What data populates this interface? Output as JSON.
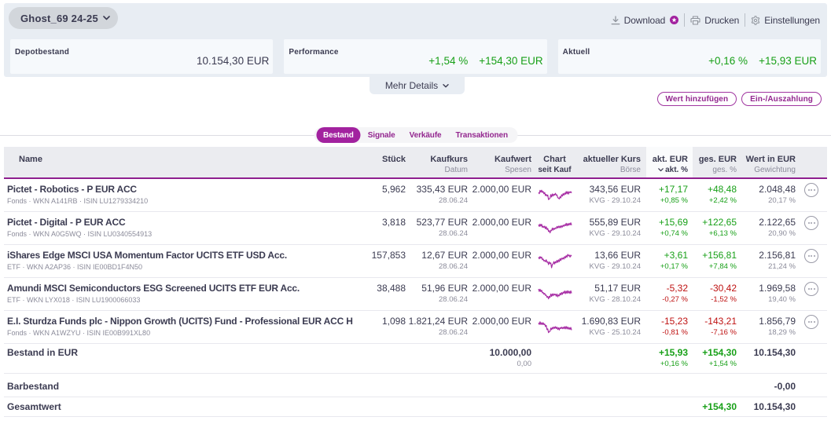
{
  "header": {
    "portfolio_name": "Ghost_69 24-25",
    "actions": {
      "download": "Download",
      "print": "Drucken",
      "settings": "Einstellungen"
    },
    "cards": [
      {
        "label": "Depotbestand",
        "value": "10.154,30 EUR"
      },
      {
        "label": "Performance",
        "pct": "+1,54 %",
        "value": "+154,30 EUR"
      },
      {
        "label": "Aktuell",
        "pct": "+0,16 %",
        "value": "+15,93 EUR"
      }
    ],
    "mehr_details": "Mehr Details"
  },
  "buttons": {
    "add_value": "Wert hinzufügen",
    "payment": "Ein-/Auszahlung"
  },
  "tabs": [
    {
      "label": "Bestand",
      "active": true
    },
    {
      "label": "Signale",
      "active": false
    },
    {
      "label": "Verkäufe",
      "active": false
    },
    {
      "label": "Transaktionen",
      "active": false
    }
  ],
  "table": {
    "columns": {
      "name": "Name",
      "stueck": "Stück",
      "kaufkurs": "Kaufkurs",
      "kaufkurs_sub": "Datum",
      "kaufwert": "Kaufwert",
      "kaufwert_sub": "Spesen",
      "chart": "Chart",
      "chart_sub": "seit Kauf",
      "kurs": "aktueller Kurs",
      "kurs_sub": "Börse",
      "akt": "akt. EUR",
      "akt_sub": "akt. %",
      "ges": "ges. EUR",
      "ges_sub": "ges. %",
      "wert": "Wert in EUR",
      "wert_sub": "Gewichtung"
    },
    "rows": [
      {
        "name": "Pictet - Robotics - P EUR ACC",
        "subtitle": "Fonds · WKN A141RB · ISIN LU1279334210",
        "stueck": "5,962",
        "kaufkurs": "335,43 EUR",
        "kaufdatum": "28.06.24",
        "kaufwert": "2.000,00 EUR",
        "kurs": "343,56 EUR",
        "kurs_sub": "KVG · 29.10.24",
        "akt": "+17,17",
        "akt_pct": "+0,85 %",
        "ges": "+48,48",
        "ges_pct": "+2,42 %",
        "wert": "2.048,48",
        "gewichtung": "20,17 %",
        "spark": [
          0.36,
          0.43,
          0.22,
          0.34,
          0.21,
          0.35,
          0.29,
          0.44,
          0.36,
          0.56,
          0.48,
          0.58,
          0.52,
          0.81,
          0.77,
          0.71,
          0.49,
          0.64,
          0.45,
          0.58,
          0.47,
          0.52,
          0.41,
          0.53,
          0.51,
          0.69,
          0.71,
          0.77,
          0.62,
          0.7,
          0.5,
          0.59,
          0.43,
          0.53,
          0.39,
          0.47,
          0.3,
          0.44,
          0.3,
          0.46,
          0.31,
          0.37,
          0.3,
          0.39
        ]
      },
      {
        "name": "Pictet - Digital - P EUR ACC",
        "subtitle": "Fonds · WKN A0G5WQ · ISIN LU0340554913",
        "stueck": "3,818",
        "kaufkurs": "523,77 EUR",
        "kaufdatum": "28.06.24",
        "kaufwert": "2.000,00 EUR",
        "kurs": "555,89 EUR",
        "kurs_sub": "KVG · 29.10.24",
        "akt": "+15,69",
        "akt_pct": "+0,74 %",
        "ges": "+122,65",
        "ges_pct": "+6,13 %",
        "wert": "2.122,65",
        "gewichtung": "20,90 %",
        "spark": [
          0.3,
          0.42,
          0.27,
          0.4,
          0.28,
          0.48,
          0.4,
          0.49,
          0.4,
          0.57,
          0.44,
          0.61,
          0.55,
          0.74,
          0.69,
          0.83,
          0.66,
          0.69,
          0.52,
          0.65,
          0.53,
          0.6,
          0.51,
          0.55,
          0.42,
          0.52,
          0.4,
          0.5,
          0.39,
          0.5,
          0.37,
          0.46,
          0.34,
          0.41,
          0.3,
          0.37,
          0.22,
          0.38,
          0.24,
          0.35,
          0.22,
          0.32,
          0.19,
          0.34
        ]
      },
      {
        "name": "iShares Edge MSCI USA Momentum Factor UCITS ETF USD Acc.",
        "subtitle": "ETF · WKN A2AP36 · ISIN IE00BD1F4N50",
        "stueck": "157,853",
        "kaufkurs": "12,67 EUR",
        "kaufdatum": "28.06.24",
        "kaufwert": "2.000,00 EUR",
        "kurs": "13,66 EUR",
        "kurs_sub": "KVG · 29.10.24",
        "akt": "+3,61",
        "akt_pct": "+0,17 %",
        "ges": "+156,81",
        "ges_pct": "+7,84 %",
        "wert": "2.156,81",
        "gewichtung": "21,24 %",
        "spark": [
          0.27,
          0.38,
          0.24,
          0.34,
          0.27,
          0.44,
          0.39,
          0.52,
          0.48,
          0.57,
          0.44,
          0.6,
          0.57,
          0.75,
          0.58,
          0.69,
          0.64,
          0.95,
          0.75,
          0.7,
          0.56,
          0.71,
          0.56,
          0.63,
          0.48,
          0.61,
          0.45,
          0.56,
          0.37,
          0.49,
          0.34,
          0.4,
          0.31,
          0.4,
          0.24,
          0.33,
          0.18,
          0.28,
          0.1,
          0.2,
          0.14,
          0.27,
          0.15,
          0.21
        ]
      },
      {
        "name": "Amundi MSCI Semiconductors ESG Screened UCITS ETF EUR Acc.",
        "subtitle": "ETF · WKN LYX018 · ISIN LU1900066033",
        "stueck": "38,488",
        "kaufkurs": "51,96 EUR",
        "kaufdatum": "28.06.24",
        "kaufwert": "2.000,00 EUR",
        "kurs": "51,17 EUR",
        "kurs_sub": "KVG · 28.10.24",
        "akt": "-5,32",
        "akt_pct": "-0,27 %",
        "ges": "-30,42",
        "ges_pct": "-1,52 %",
        "wert": "1.969,58",
        "gewichtung": "19,40 %",
        "spark": [
          0.2,
          0.36,
          0.22,
          0.37,
          0.28,
          0.45,
          0.42,
          0.54,
          0.48,
          0.61,
          0.59,
          0.73,
          0.68,
          0.83,
          0.67,
          0.74,
          0.52,
          0.67,
          0.51,
          0.63,
          0.51,
          0.58,
          0.53,
          0.66,
          0.52,
          0.7,
          0.58,
          0.64,
          0.48,
          0.58,
          0.43,
          0.55,
          0.4,
          0.47,
          0.33,
          0.5,
          0.34,
          0.48,
          0.31,
          0.46,
          0.35,
          0.49,
          0.32,
          0.48
        ]
      },
      {
        "name": "E.I. Sturdza Funds plc - Nippon Growth (UCITS) Fund - Professional EUR ACC H",
        "subtitle": "Fonds · WKN A1WZYU · ISIN IE00B991XL80",
        "stueck": "1,098",
        "kaufkurs": "1.821,24 EUR",
        "kaufdatum": "28.06.24",
        "kaufwert": "2.000,00 EUR",
        "kurs": "1.690,83 EUR",
        "kurs_sub": "KVG · 25.10.24",
        "akt": "-15,23",
        "akt_pct": "-0,81 %",
        "ges": "-143,21",
        "ges_pct": "-7,16 %",
        "wert": "1.856,79",
        "gewichtung": "18,29 %",
        "spark": [
          0.25,
          0.36,
          0.19,
          0.36,
          0.25,
          0.37,
          0.25,
          0.37,
          0.33,
          0.49,
          0.42,
          0.69,
          0.64,
          0.88,
          0.81,
          0.8,
          0.59,
          0.69,
          0.55,
          0.64,
          0.52,
          0.61,
          0.5,
          0.62,
          0.53,
          0.68,
          0.57,
          0.71,
          0.56,
          0.62,
          0.53,
          0.63,
          0.54,
          0.63,
          0.5,
          0.64,
          0.49,
          0.64,
          0.52,
          0.66,
          0.56,
          0.68,
          0.55,
          0.72
        ]
      }
    ],
    "totals": {
      "bestand": {
        "label": "Bestand in EUR",
        "kaufwert": "10.000,00",
        "spesen": "0,00",
        "akt": "+15,93",
        "akt_pct": "+0,16 %",
        "ges": "+154,30",
        "ges_pct": "+1,54 %",
        "wert": "10.154,30"
      },
      "barbestand": {
        "label": "Barbestand",
        "wert": "-0,00"
      },
      "gesamtwert": {
        "label": "Gesamtwert",
        "ges": "+154,30",
        "wert": "10.154,30"
      }
    }
  },
  "chart_data": {
    "type": "line",
    "note": "sparklines per row under table.rows[].spark, values normalized 0=top 1=bottom",
    "color": "#a62ba3"
  },
  "colors": {
    "brand_purple": "#93278f",
    "active_tab": "#a2229f",
    "positive_green": "#18a018",
    "negative_red": "#bf1212",
    "panel_blue": "#e8edf3",
    "header_gray": "#ebecf0",
    "text_dark": "#3b3b51",
    "text_gray": "#8b8b9a"
  }
}
